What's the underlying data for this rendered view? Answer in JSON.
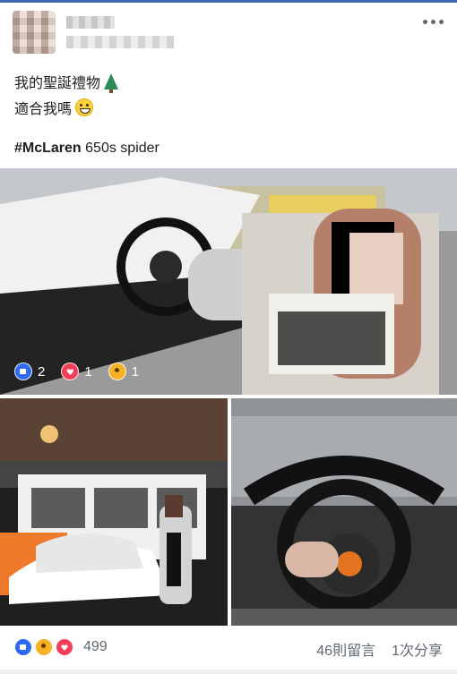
{
  "post": {
    "line1": "我的聖誕禮物",
    "line2": "適合我嗎",
    "hashtag": "#McLaren",
    "hashtag_rest": " 650s spider"
  },
  "overlay_reactions": [
    {
      "icon": "like-icon",
      "count": "2"
    },
    {
      "icon": "love-icon",
      "count": "1"
    },
    {
      "icon": "wow-icon",
      "count": "1"
    }
  ],
  "footer": {
    "reactions_total": "499",
    "comments": "46則留言",
    "shares": "1次分享"
  },
  "colors": {
    "brand_blue": "#4267b2",
    "like_blue": "#2d6bf0",
    "love_red": "#f33e58",
    "wow_yellow": "#f7b125"
  }
}
